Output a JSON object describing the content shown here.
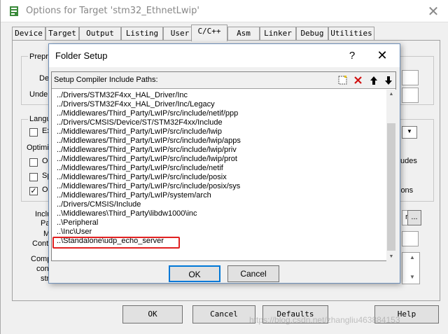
{
  "outer": {
    "title": "Options for Target 'stm32_EthnetLwip'",
    "close_glyph": "✕",
    "tabs": [
      "Device",
      "Target",
      "Output",
      "Listing",
      "User",
      "C/C++",
      "Asm",
      "Linker",
      "Debug",
      "Utilities"
    ],
    "active_tab": "C/C++",
    "bg": {
      "prepro_label": "Prepro",
      "de_label": "De",
      "unde_label": "Unde",
      "langu_label": "Langu",
      "ex_label": "Ex",
      "optimiz_label": "Optimiz",
      "op_label": "Op",
      "sp_label": "Sp",
      "on_label": "On",
      "inclu_label": "Inclu",
      "pa_label": "Pa",
      "m_label": "M",
      "contr_label": "Contr",
      "comp_label": "Comp",
      "con_label": "con",
      "str_label": "str",
      "udes_label": "udes",
      "ions_label": "ions",
      "r_label": "r",
      "dots_label": "...",
      "check_glyph": "✓",
      "dropdown_glyph": "▼",
      "up_glyph": "▲",
      "down_glyph": "▼"
    },
    "buttons": {
      "ok": "OK",
      "cancel": "Cancel",
      "defaults": "Defaults",
      "help": "Help"
    }
  },
  "folder_setup": {
    "title": "Folder Setup",
    "help_glyph": "?",
    "close_glyph": "✕",
    "header_label": "Setup Compiler Include Paths:",
    "toolbar": {
      "new_glyph": "⬚",
      "delete_glyph": "✕",
      "up_glyph": "🡅",
      "down_glyph": "🡇"
    },
    "paths": [
      "../Drivers/STM32F4xx_HAL_Driver/Inc",
      "../Drivers/STM32F4xx_HAL_Driver/Inc/Legacy",
      "../Middlewares/Third_Party/LwIP/src/include/netif/ppp",
      "../Drivers/CMSIS/Device/ST/STM32F4xx/Include",
      "../Middlewares/Third_Party/LwIP/src/include/lwip",
      "../Middlewares/Third_Party/LwIP/src/include/lwip/apps",
      "../Middlewares/Third_Party/LwIP/src/include/lwip/priv",
      "../Middlewares/Third_Party/LwIP/src/include/lwip/prot",
      "../Middlewares/Third_Party/LwIP/src/include/netif",
      "../Middlewares/Third_Party/LwIP/src/include/posix",
      "../Middlewares/Third_Party/LwIP/src/include/posix/sys",
      "../Middlewares/Third_Party/LwIP/system/arch",
      "../Drivers/CMSIS/Include",
      "..\\Middlewares\\Third_Party\\libdw1000\\inc",
      "..\\Peripheral",
      "..\\Inc\\User",
      "..\\Standalone\\udp_echo_server"
    ],
    "scroll_up_glyph": "▲",
    "scroll_down_glyph": "▼",
    "buttons": {
      "ok": "OK",
      "cancel": "Cancel"
    }
  },
  "watermark": "https://blog.csdn.net/zhangliu463884153",
  "colors": {
    "highlight_border": "#e02020",
    "focus_border": "#0078d7",
    "delete_red": "#d01010"
  }
}
